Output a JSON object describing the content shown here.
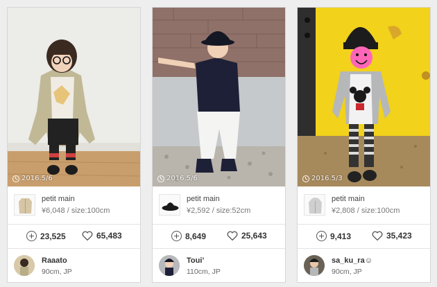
{
  "cards": [
    {
      "date": "2016.5/6",
      "item": {
        "name": "petit main",
        "meta": "¥6,048 / size:100cm",
        "icon": "trench-coat-thumbnail"
      },
      "adds": "23,525",
      "likes": "65,483",
      "user": {
        "name": "Raaato",
        "meta": "90cm, JP"
      }
    },
    {
      "date": "2016.5/6",
      "item": {
        "name": "petit main",
        "meta": "¥2,592 / size:52cm",
        "icon": "bucket-hat-thumbnail"
      },
      "adds": "8,649",
      "likes": "25,643",
      "user": {
        "name": "Toui’",
        "meta": "110cm, JP"
      }
    },
    {
      "date": "2016.5/3",
      "item": {
        "name": "petit main",
        "meta": "¥2,808 / size:100cm",
        "icon": "hoodie-thumbnail"
      },
      "adds": "9,413",
      "likes": "35,423",
      "user": {
        "name": "sa_ku_ra☺",
        "meta": "90cm, JP"
      }
    }
  ]
}
